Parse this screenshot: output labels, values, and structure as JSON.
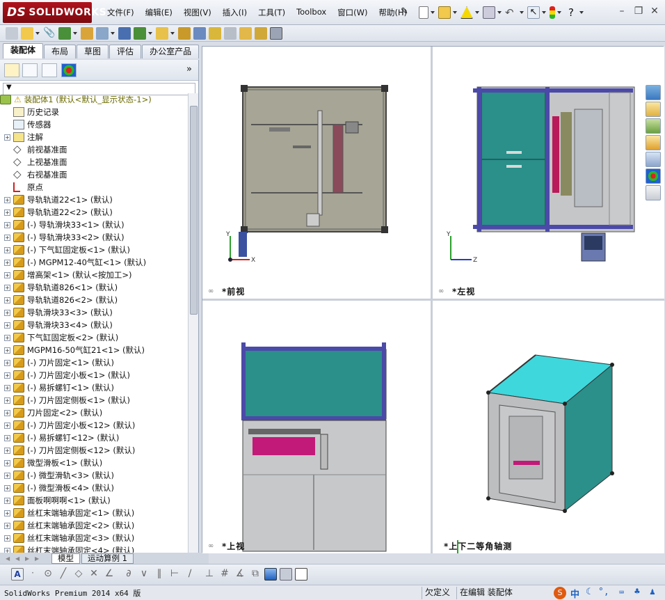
{
  "app": {
    "logo_text": "SOLIDWORKS",
    "logo_prefix": "DS"
  },
  "menu": [
    {
      "label": "文件(F)"
    },
    {
      "label": "编辑(E)"
    },
    {
      "label": "视图(V)"
    },
    {
      "label": "插入(I)"
    },
    {
      "label": "工具(T)"
    },
    {
      "label": "Toolbox"
    },
    {
      "label": "窗口(W)"
    },
    {
      "label": "帮助(H)"
    }
  ],
  "command_tabs": [
    "装配体",
    "布局",
    "草图",
    "评估",
    "办公室产品"
  ],
  "tree": {
    "root": "装配体1  (默认<默认_显示状态-1>)",
    "items": [
      {
        "label": "历史记录",
        "icon": "history-icon",
        "exp": false
      },
      {
        "label": "传感器",
        "icon": "sensor-icon",
        "exp": false
      },
      {
        "label": "注解",
        "icon": "annotation-icon",
        "exp": true
      },
      {
        "label": "前视基准面",
        "icon": "plane-icon",
        "exp": false
      },
      {
        "label": "上视基准面",
        "icon": "plane-icon",
        "exp": false
      },
      {
        "label": "右视基准面",
        "icon": "plane-icon",
        "exp": false
      },
      {
        "label": "原点",
        "icon": "origin-icon",
        "exp": false
      },
      {
        "label": "导轨轨道22<1> (默认)",
        "icon": "part-icon",
        "exp": true
      },
      {
        "label": "导轨轨道22<2> (默认)",
        "icon": "part-icon",
        "exp": true
      },
      {
        "label": "(-) 导轨滑块33<1> (默认)",
        "icon": "part-icon",
        "exp": true
      },
      {
        "label": "(-) 导轨滑块33<2> (默认)",
        "icon": "part-icon",
        "exp": true
      },
      {
        "label": "(-) 下气缸固定板<1> (默认)",
        "icon": "part-icon",
        "exp": true
      },
      {
        "label": "(-) MGPM12-40气缸<1> (默认)",
        "icon": "part-icon",
        "exp": true
      },
      {
        "label": "增高架<1> (默认<按加工>)",
        "icon": "part-icon",
        "exp": true
      },
      {
        "label": "导轨轨道826<1> (默认)",
        "icon": "part-icon",
        "exp": true
      },
      {
        "label": "导轨轨道826<2> (默认)",
        "icon": "part-icon",
        "exp": true
      },
      {
        "label": "导轨滑块33<3> (默认)",
        "icon": "part-icon",
        "exp": true
      },
      {
        "label": "导轨滑块33<4> (默认)",
        "icon": "part-icon",
        "exp": true
      },
      {
        "label": "下气缸固定板<2> (默认)",
        "icon": "part-icon",
        "exp": true
      },
      {
        "label": "MGPM16-50气缸21<1> (默认)",
        "icon": "part-icon",
        "exp": true
      },
      {
        "label": "(-) 刀片固定<1> (默认)",
        "icon": "part-icon",
        "exp": true
      },
      {
        "label": "(-) 刀片固定小板<1> (默认)",
        "icon": "part-icon",
        "exp": true
      },
      {
        "label": "(-) 易拆螺钉<1> (默认)",
        "icon": "part-icon",
        "exp": true
      },
      {
        "label": "(-) 刀片固定侧板<1> (默认)",
        "icon": "part-icon",
        "exp": true
      },
      {
        "label": "刀片固定<2> (默认)",
        "icon": "part-icon",
        "exp": true
      },
      {
        "label": "(-) 刀片固定小板<12> (默认)",
        "icon": "part-icon",
        "exp": true
      },
      {
        "label": "(-) 易拆螺钉<12> (默认)",
        "icon": "part-icon",
        "exp": true
      },
      {
        "label": "(-) 刀片固定侧板<12> (默认)",
        "icon": "part-icon",
        "exp": true
      },
      {
        "label": "微型滑板<1> (默认)",
        "icon": "part-icon",
        "exp": true
      },
      {
        "label": "(-) 微型滑轨<3> (默认)",
        "icon": "part-icon",
        "exp": true
      },
      {
        "label": "(-) 微型滑板<4> (默认)",
        "icon": "part-icon",
        "exp": true
      },
      {
        "label": "面板啊啊啊<1> (默认)",
        "icon": "part-icon",
        "exp": true
      },
      {
        "label": "丝杠末端轴承固定<1> (默认)",
        "icon": "part-icon",
        "exp": true
      },
      {
        "label": "丝杠末端轴承固定<2> (默认)",
        "icon": "part-icon",
        "exp": true
      },
      {
        "label": "丝杠末端轴承固定<3> (默认)",
        "icon": "part-icon",
        "exp": true
      },
      {
        "label": "丝杠末端轴承固定<4> (默认)",
        "icon": "part-icon",
        "exp": true
      }
    ]
  },
  "bottom_tabs": [
    "模型",
    "运动算例 1"
  ],
  "viewports": {
    "front": "*前视",
    "left": "*左视",
    "top": "*上视",
    "iso": "*上下二等角轴测"
  },
  "status": {
    "product": "SolidWorks Premium 2014 x64 版",
    "state1": "欠定义",
    "state2": "在编辑 装配体",
    "ime": "中"
  },
  "colors": {
    "frame_blue": "#4b4aa8",
    "panel_teal": "#2b8f8a",
    "panel_cyan": "#3ed7dc",
    "magenta": "#c21a78",
    "brand_red": "#b0121b"
  }
}
